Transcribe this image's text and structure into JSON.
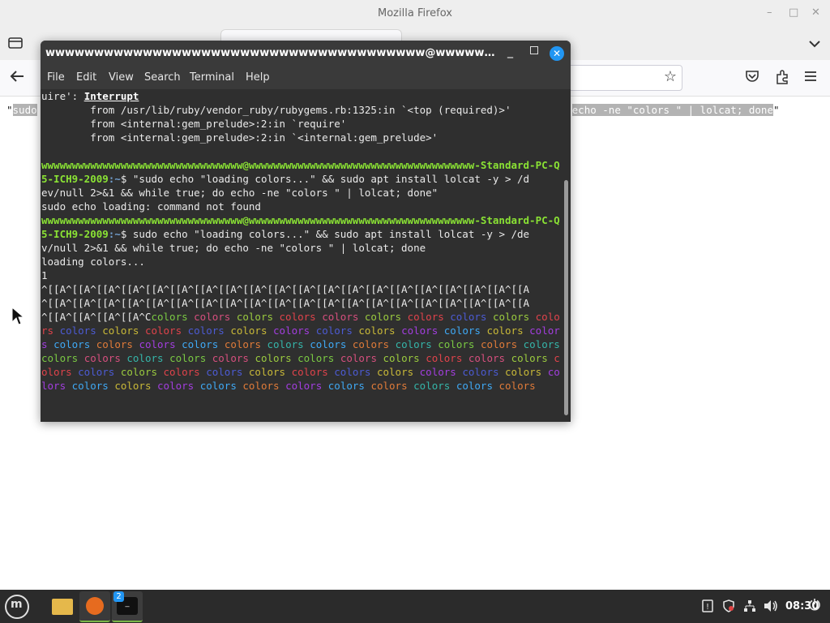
{
  "firefox": {
    "window_title": "Mozilla Firefox",
    "window_controls": {
      "minimize": "–",
      "maximize": "□",
      "close": "✕"
    },
    "tab_left_icon": "tabs-icon",
    "tab_overflow_icon": "chevron-down-icon",
    "back_icon": "back-arrow-icon",
    "bookmark_icon": "star-icon",
    "toolbar_icons": [
      "pocket-icon",
      "extensions-icon",
      "hamburger-menu-icon"
    ],
    "selected_text_left": "\"",
    "selected_text_left_sel": "sudo",
    "selected_text_right_sel": "echo -ne \"colors \" | lolcat; done",
    "selected_text_right_end": "\""
  },
  "terminal": {
    "title": "wwwwwwwwwwwwwwwwwwwwwwwwwwwwwwwwwwwwwww@wwwwwwwwwwwwwwwwwwww...",
    "window_controls": {
      "minimize": "_",
      "close": "✕"
    },
    "menu": [
      "File",
      "Edit",
      "View",
      "Search",
      "Terminal",
      "Help"
    ],
    "lines": {
      "l1_prefix": "uire': ",
      "l1_bold": "Interrupt",
      "l2": "        from /usr/lib/ruby/vendor_ruby/rubygems.rb:1325:in `<top (required)>'",
      "l3": "        from <internal:gem_prelude>:2:in `require'",
      "l4": "        from <internal:gem_prelude>:2:in `<internal:gem_prelude>'",
      "prompt_user_a": "wwwwwwwwwwwwwwwwwwwwwwwwwwwwwwwww@wwwwwwwwwwwwwwwwwwwwwwwwwwwwwwwwwwwww-Standard-PC-Q3",
      "prompt_user_b": "5-ICH9-2009",
      "prompt_path": ":~",
      "cmd1_a": "$ \"sudo echo \"loading colors...\" && sudo apt install lolcat -y > /d",
      "cmd1_b": "ev/null 2>&1 && while true; do echo -ne \"colors \" | lolcat; done\"",
      "err1": "sudo echo loading: command not found",
      "cmd2_a": "$ sudo echo \"loading colors...\" && sudo apt install lolcat -y > /de",
      "cmd2_b": "v/null 2>&1 && while true; do echo -ne \"colors \" | lolcat; done",
      "out1": "loading colors...",
      "out2": "1",
      "esc1": "^[[A^[[A^[[A^[[A^[[A^[[A^[[A^[[A^[[A^[[A^[[A^[[A^[[A^[[A^[[A^[[A^[[A^[[A^[[A^[[A",
      "esc2": "^[[A^[[A^[[A^[[A^[[A^[[A^[[A^[[A^[[A^[[A^[[A^[[A^[[A^[[A^[[A^[[A^[[A^[[A^[[A^[[A",
      "esc3": "^[[A^[[A^[[A^[[A^C"
    },
    "colors_word": "colors",
    "colors_palette": [
      "#7ac943",
      "#3fa9f5",
      "#4c5bd4",
      "#d64f7e",
      "#e07b39",
      "#c9b938",
      "#9bcb3f",
      "#35b5a9",
      "#a33ee0",
      "#e0434b"
    ]
  },
  "taskbar": {
    "menu_icon": "mint-menu-icon",
    "apps": [
      {
        "name": "files",
        "icon": "folder-icon"
      },
      {
        "name": "firefox",
        "icon": "firefox-icon"
      },
      {
        "name": "terminal",
        "icon": "terminal-icon",
        "badge": "2"
      }
    ],
    "tray_icons": [
      "update-manager-icon",
      "shield-icon",
      "network-icon",
      "volume-icon"
    ],
    "clock": "08:30",
    "power_icon": "power-icon"
  }
}
